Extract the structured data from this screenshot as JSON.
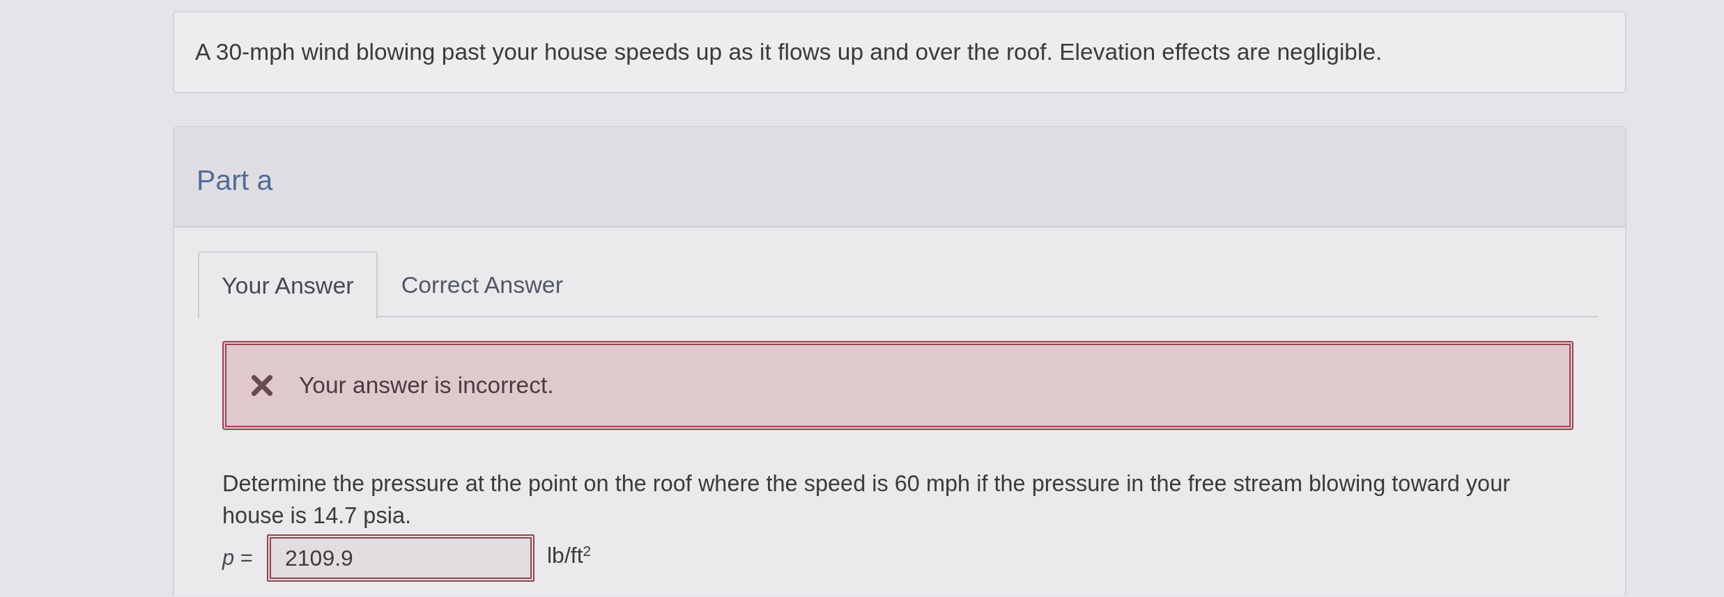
{
  "problem": {
    "text": "A 30-mph wind blowing past your house speeds up as it flows up and over the roof. Elevation effects are negligible."
  },
  "part": {
    "title": "Part a",
    "tabs": [
      {
        "label": "Your Answer",
        "selected": true
      },
      {
        "label": "Correct Answer",
        "selected": false
      }
    ],
    "feedback": {
      "kind": "incorrect",
      "message": "Your answer is incorrect."
    },
    "question": "Determine the pressure at the point on the roof where the speed is 60 mph if the pressure in the free stream blowing toward your house is 14.7 psia.",
    "answer": {
      "label": "*p* =",
      "value": "2109.9",
      "unit": "lb/ft$^{2}$"
    }
  }
}
